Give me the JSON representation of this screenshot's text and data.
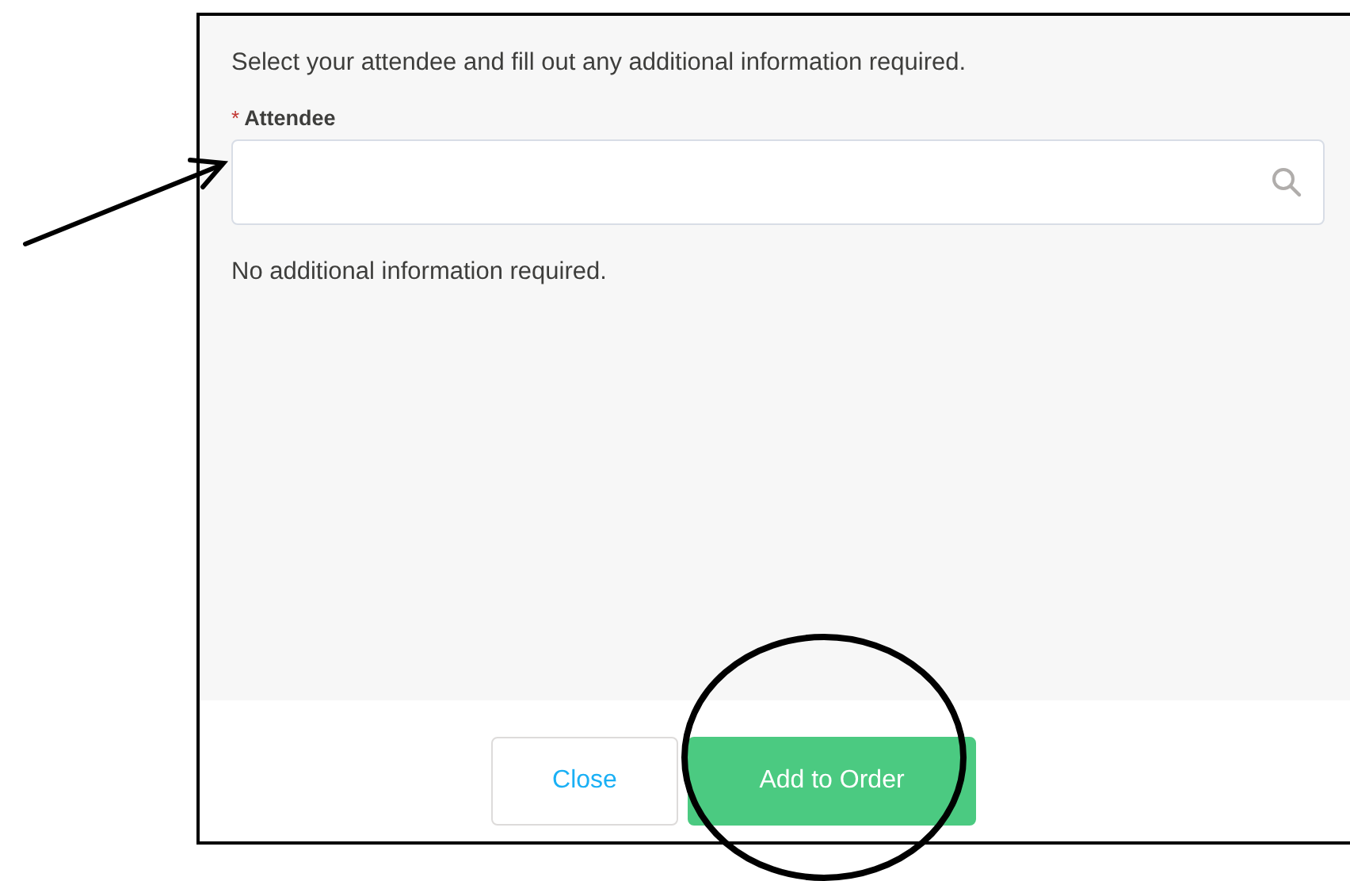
{
  "dialog": {
    "instruction": "Select your attendee and fill out any additional information required.",
    "field": {
      "label": "Attendee",
      "required_mark": "*"
    },
    "note": "No additional information required.",
    "buttons": [
      {
        "label": "Close",
        "kind": "secondary"
      },
      {
        "label": "Add to Order",
        "kind": "primary"
      }
    ]
  }
}
